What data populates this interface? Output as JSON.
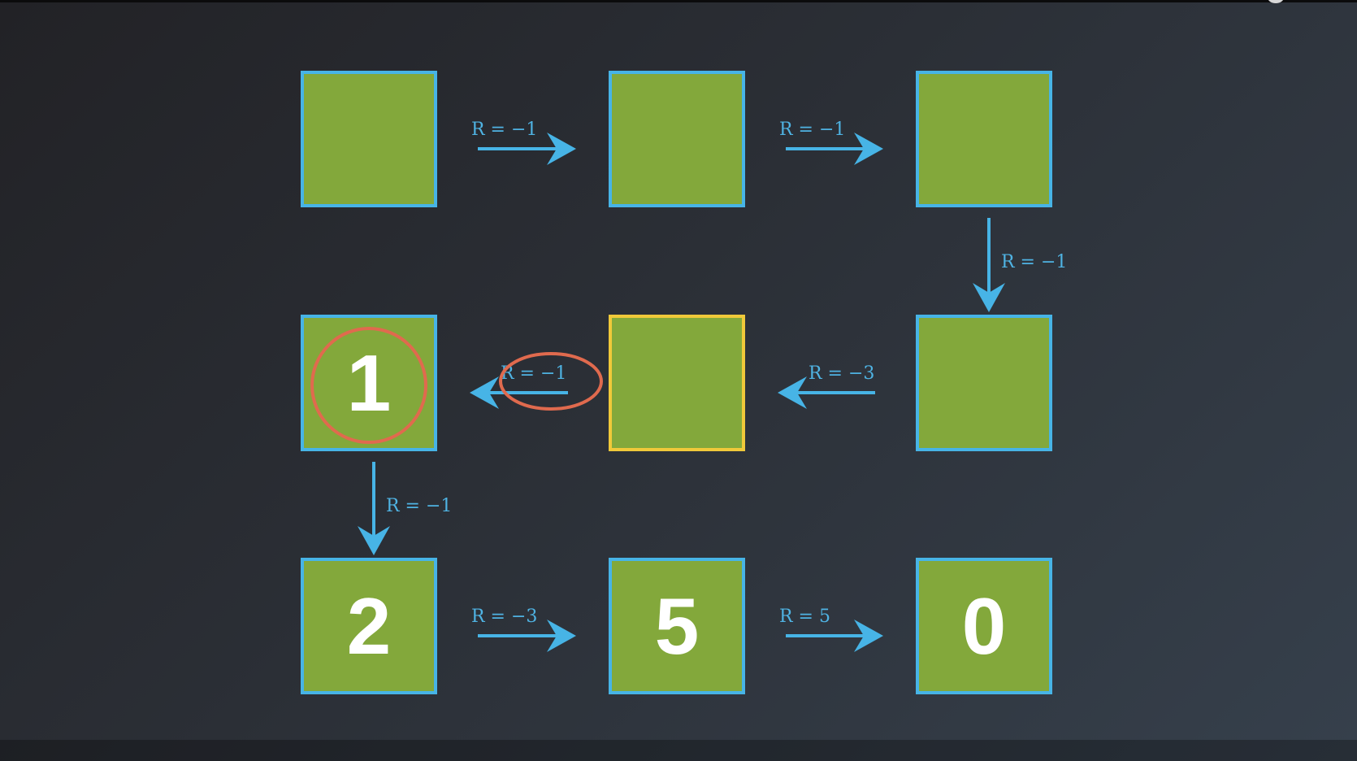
{
  "colors": {
    "cell_fill": "#83a83b",
    "cell_border": "#47b4e6",
    "current_cell_border": "#f0c93a",
    "arrow": "#47b4e6",
    "highlight_circle": "#e06a4e",
    "value_text": "#ffffff"
  },
  "grid": {
    "rows": [
      [
        {
          "value": ""
        },
        {
          "value": ""
        },
        {
          "value": ""
        }
      ],
      [
        {
          "value": "1",
          "highlighted": true
        },
        {
          "value": "",
          "current": true
        },
        {
          "value": ""
        }
      ],
      [
        {
          "value": "2"
        },
        {
          "value": "5"
        },
        {
          "value": "0"
        }
      ]
    ]
  },
  "transitions": [
    {
      "from": "r0c0",
      "to": "r0c1",
      "label": "R = −1"
    },
    {
      "from": "r0c1",
      "to": "r0c2",
      "label": "R = −1"
    },
    {
      "from": "r0c2",
      "to": "r1c2",
      "label": "R = −1"
    },
    {
      "from": "r1c2",
      "to": "r1c1",
      "label": "R = −3"
    },
    {
      "from": "r1c1",
      "to": "r1c0",
      "label": "R = −1",
      "highlighted": true
    },
    {
      "from": "r1c0",
      "to": "r2c0",
      "label": "R = −1"
    },
    {
      "from": "r2c0",
      "to": "r2c1",
      "label": "R = −3"
    },
    {
      "from": "r2c1",
      "to": "r2c2",
      "label": "R = 5"
    }
  ]
}
